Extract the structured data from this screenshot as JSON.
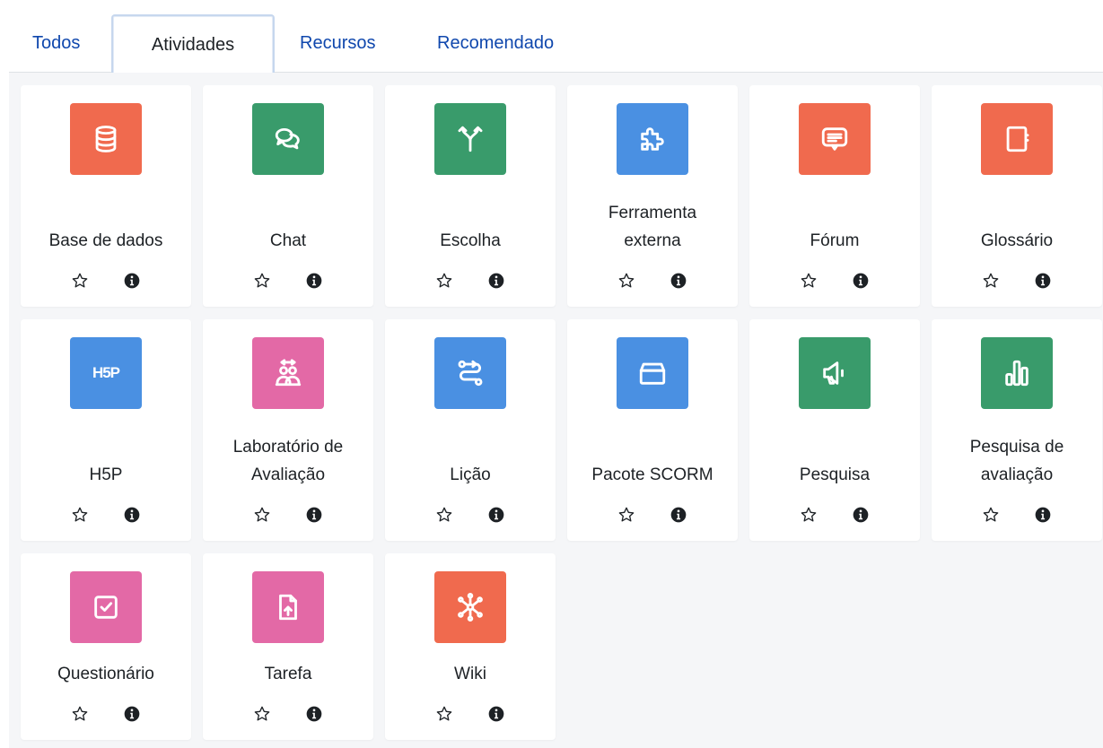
{
  "tabs": [
    {
      "label": "Todos"
    },
    {
      "label": "Atividades"
    },
    {
      "label": "Recursos"
    },
    {
      "label": "Recomendado"
    }
  ],
  "colors": {
    "link": "#0f47ad",
    "orange": "#f06a4e",
    "green": "#399b6b",
    "blue": "#4a90e2",
    "pink": "#e369a6"
  },
  "modules": [
    {
      "lines": [
        "Base de dados"
      ],
      "icon": "database-icon",
      "color": "#f06a4e"
    },
    {
      "lines": [
        "Chat"
      ],
      "icon": "chat-icon",
      "color": "#399b6b"
    },
    {
      "lines": [
        "Escolha"
      ],
      "icon": "choice-icon",
      "color": "#399b6b"
    },
    {
      "lines": [
        "Ferramenta",
        "externa"
      ],
      "icon": "puzzle-icon",
      "color": "#4a90e2"
    },
    {
      "lines": [
        "Fórum"
      ],
      "icon": "forum-icon",
      "color": "#f06a4e"
    },
    {
      "lines": [
        "Glossário"
      ],
      "icon": "glossary-icon",
      "color": "#f06a4e"
    },
    {
      "lines": [
        "H5P"
      ],
      "icon": "h5p-icon",
      "icon_text": "H5P",
      "color": "#4a90e2"
    },
    {
      "lines": [
        "Laboratório de",
        "Avaliação"
      ],
      "icon": "workshop-icon",
      "color": "#e369a6"
    },
    {
      "lines": [
        "Lição"
      ],
      "icon": "lesson-icon",
      "color": "#4a90e2"
    },
    {
      "lines": [
        "Pacote SCORM"
      ],
      "icon": "scorm-package-icon",
      "color": "#4a90e2"
    },
    {
      "lines": [
        "Pesquisa"
      ],
      "icon": "survey-icon",
      "color": "#399b6b"
    },
    {
      "lines": [
        "Pesquisa de",
        "avaliação"
      ],
      "icon": "feedback-icon",
      "color": "#399b6b"
    },
    {
      "lines": [
        "Questionário"
      ],
      "icon": "quiz-icon",
      "color": "#e369a6"
    },
    {
      "lines": [
        "Tarefa"
      ],
      "icon": "assignment-icon",
      "color": "#e369a6"
    },
    {
      "lines": [
        "Wiki"
      ],
      "icon": "wiki-icon",
      "color": "#f06a4e"
    }
  ]
}
